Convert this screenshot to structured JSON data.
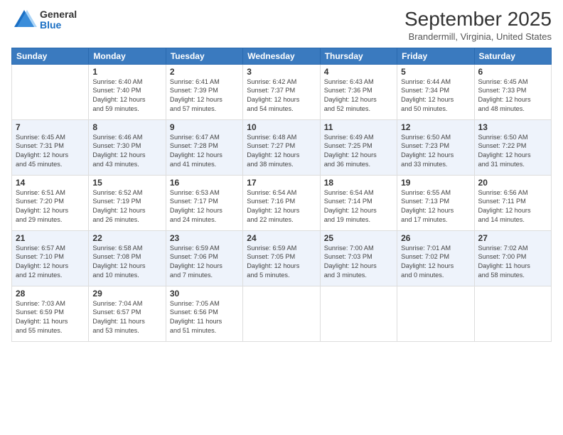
{
  "logo": {
    "general": "General",
    "blue": "Blue"
  },
  "header": {
    "title": "September 2025",
    "subtitle": "Brandermill, Virginia, United States"
  },
  "weekdays": [
    "Sunday",
    "Monday",
    "Tuesday",
    "Wednesday",
    "Thursday",
    "Friday",
    "Saturday"
  ],
  "weeks": [
    [
      {
        "day": "",
        "info": ""
      },
      {
        "day": "1",
        "info": "Sunrise: 6:40 AM\nSunset: 7:40 PM\nDaylight: 12 hours\nand 59 minutes."
      },
      {
        "day": "2",
        "info": "Sunrise: 6:41 AM\nSunset: 7:39 PM\nDaylight: 12 hours\nand 57 minutes."
      },
      {
        "day": "3",
        "info": "Sunrise: 6:42 AM\nSunset: 7:37 PM\nDaylight: 12 hours\nand 54 minutes."
      },
      {
        "day": "4",
        "info": "Sunrise: 6:43 AM\nSunset: 7:36 PM\nDaylight: 12 hours\nand 52 minutes."
      },
      {
        "day": "5",
        "info": "Sunrise: 6:44 AM\nSunset: 7:34 PM\nDaylight: 12 hours\nand 50 minutes."
      },
      {
        "day": "6",
        "info": "Sunrise: 6:45 AM\nSunset: 7:33 PM\nDaylight: 12 hours\nand 48 minutes."
      }
    ],
    [
      {
        "day": "7",
        "info": "Sunrise: 6:45 AM\nSunset: 7:31 PM\nDaylight: 12 hours\nand 45 minutes."
      },
      {
        "day": "8",
        "info": "Sunrise: 6:46 AM\nSunset: 7:30 PM\nDaylight: 12 hours\nand 43 minutes."
      },
      {
        "day": "9",
        "info": "Sunrise: 6:47 AM\nSunset: 7:28 PM\nDaylight: 12 hours\nand 41 minutes."
      },
      {
        "day": "10",
        "info": "Sunrise: 6:48 AM\nSunset: 7:27 PM\nDaylight: 12 hours\nand 38 minutes."
      },
      {
        "day": "11",
        "info": "Sunrise: 6:49 AM\nSunset: 7:25 PM\nDaylight: 12 hours\nand 36 minutes."
      },
      {
        "day": "12",
        "info": "Sunrise: 6:50 AM\nSunset: 7:23 PM\nDaylight: 12 hours\nand 33 minutes."
      },
      {
        "day": "13",
        "info": "Sunrise: 6:50 AM\nSunset: 7:22 PM\nDaylight: 12 hours\nand 31 minutes."
      }
    ],
    [
      {
        "day": "14",
        "info": "Sunrise: 6:51 AM\nSunset: 7:20 PM\nDaylight: 12 hours\nand 29 minutes."
      },
      {
        "day": "15",
        "info": "Sunrise: 6:52 AM\nSunset: 7:19 PM\nDaylight: 12 hours\nand 26 minutes."
      },
      {
        "day": "16",
        "info": "Sunrise: 6:53 AM\nSunset: 7:17 PM\nDaylight: 12 hours\nand 24 minutes."
      },
      {
        "day": "17",
        "info": "Sunrise: 6:54 AM\nSunset: 7:16 PM\nDaylight: 12 hours\nand 22 minutes."
      },
      {
        "day": "18",
        "info": "Sunrise: 6:54 AM\nSunset: 7:14 PM\nDaylight: 12 hours\nand 19 minutes."
      },
      {
        "day": "19",
        "info": "Sunrise: 6:55 AM\nSunset: 7:13 PM\nDaylight: 12 hours\nand 17 minutes."
      },
      {
        "day": "20",
        "info": "Sunrise: 6:56 AM\nSunset: 7:11 PM\nDaylight: 12 hours\nand 14 minutes."
      }
    ],
    [
      {
        "day": "21",
        "info": "Sunrise: 6:57 AM\nSunset: 7:10 PM\nDaylight: 12 hours\nand 12 minutes."
      },
      {
        "day": "22",
        "info": "Sunrise: 6:58 AM\nSunset: 7:08 PM\nDaylight: 12 hours\nand 10 minutes."
      },
      {
        "day": "23",
        "info": "Sunrise: 6:59 AM\nSunset: 7:06 PM\nDaylight: 12 hours\nand 7 minutes."
      },
      {
        "day": "24",
        "info": "Sunrise: 6:59 AM\nSunset: 7:05 PM\nDaylight: 12 hours\nand 5 minutes."
      },
      {
        "day": "25",
        "info": "Sunrise: 7:00 AM\nSunset: 7:03 PM\nDaylight: 12 hours\nand 3 minutes."
      },
      {
        "day": "26",
        "info": "Sunrise: 7:01 AM\nSunset: 7:02 PM\nDaylight: 12 hours\nand 0 minutes."
      },
      {
        "day": "27",
        "info": "Sunrise: 7:02 AM\nSunset: 7:00 PM\nDaylight: 11 hours\nand 58 minutes."
      }
    ],
    [
      {
        "day": "28",
        "info": "Sunrise: 7:03 AM\nSunset: 6:59 PM\nDaylight: 11 hours\nand 55 minutes."
      },
      {
        "day": "29",
        "info": "Sunrise: 7:04 AM\nSunset: 6:57 PM\nDaylight: 11 hours\nand 53 minutes."
      },
      {
        "day": "30",
        "info": "Sunrise: 7:05 AM\nSunset: 6:56 PM\nDaylight: 11 hours\nand 51 minutes."
      },
      {
        "day": "",
        "info": ""
      },
      {
        "day": "",
        "info": ""
      },
      {
        "day": "",
        "info": ""
      },
      {
        "day": "",
        "info": ""
      }
    ]
  ]
}
